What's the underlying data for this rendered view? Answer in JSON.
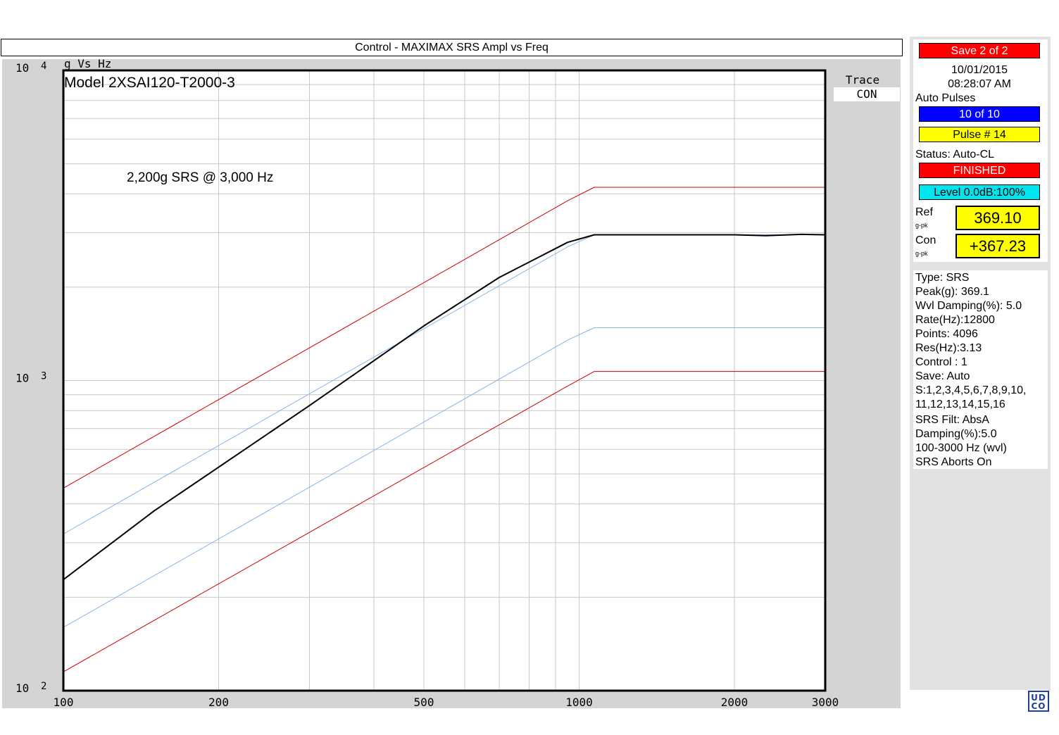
{
  "window_title": "Control - MAXIMAX SRS Ampl  vs  Freq",
  "chart_data": {
    "type": "line",
    "scale": "log-log",
    "grid": true,
    "yunit_label": "g Vs Hz",
    "annotation_model": "Model 2XSAI120-T2000-3",
    "annotation_spec": "2,200g SRS @ 3,000 Hz",
    "xlim": [
      100,
      3000
    ],
    "ylim": [
      100,
      10000
    ],
    "x_ticks": [
      {
        "value": 100,
        "label": "100"
      },
      {
        "value": 200,
        "label": "200"
      },
      {
        "value": 500,
        "label": "500"
      },
      {
        "value": 1000,
        "label": "1000"
      },
      {
        "value": 2000,
        "label": "2000"
      },
      {
        "value": 3000,
        "label": "3000"
      }
    ],
    "y_ticks": [
      {
        "value": 10000,
        "base": "10",
        "exp": "4"
      },
      {
        "value": 1000,
        "base": "10",
        "exp": "3"
      },
      {
        "value": 100,
        "base": "10",
        "exp": "2"
      }
    ],
    "series": [
      {
        "role": "upper-abort",
        "color": "#cc0000",
        "width": 1,
        "x": [
          100,
          950,
          1070,
          3000
        ],
        "y": [
          450,
          3800,
          4200,
          4200
        ]
      },
      {
        "role": "upper-tolerance",
        "color": "#88b4e8",
        "width": 1,
        "x": [
          100,
          950,
          1070,
          3000
        ],
        "y": [
          320,
          2700,
          2950,
          2950
        ]
      },
      {
        "role": "lower-tolerance",
        "color": "#88b4e8",
        "width": 1,
        "x": [
          100,
          950,
          1070,
          3000
        ],
        "y": [
          160,
          1350,
          1480,
          1480
        ]
      },
      {
        "role": "lower-abort",
        "color": "#cc0000",
        "width": 1,
        "x": [
          100,
          950,
          1070,
          3000
        ],
        "y": [
          115,
          960,
          1070,
          1070
        ]
      },
      {
        "role": "control",
        "color": "#000000",
        "width": 2,
        "x": [
          100,
          150,
          300,
          500,
          700,
          950,
          1070,
          2000,
          2300,
          2700,
          3000
        ],
        "y": [
          228,
          380,
          830,
          1500,
          2150,
          2790,
          2950,
          2950,
          2930,
          2960,
          2950
        ]
      }
    ]
  },
  "trace": {
    "label": "Trace",
    "value": "CON"
  },
  "sidebar": {
    "save_status": "Save   2 of   2",
    "date": "10/01/2015",
    "time": "08:28:07 AM",
    "auto_pulses_label": "Auto Pulses",
    "pulses_count": "10 of  10",
    "pulse_number": "Pulse #  14",
    "status": "Status: Auto-CL",
    "finished": "FINISHED",
    "level": "Level 0.0dB:100%",
    "ref_label": "Ref",
    "ref_unit": "g-pk",
    "ref_value": "369.10",
    "con_label": "Con",
    "con_unit": "g-pk",
    "con_value": "+367.23"
  },
  "info": [
    "Type: SRS",
    "Peak(g): 369.1",
    "Wvl Damping(%): 5.0",
    "Rate(Hz):12800",
    "Points: 4096",
    "Res(Hz):3.13",
    "Control :  1",
    "Save: Auto",
    "S:1,2,3,4,5,6,7,8,9,10,",
    "11,12,13,14,15,16",
    "SRS Filt: AbsA",
    "Damping(%):5.0",
    "100-3000 Hz (wvl)",
    "SRS Aborts On"
  ],
  "logo": "UD CO",
  "colors": {
    "save": "#ff0000",
    "pulses": "#0000ff",
    "pulse_number": "#ffff00",
    "finished": "#ff0000",
    "level": "#00e5f0",
    "value_box": "#ffff00"
  }
}
